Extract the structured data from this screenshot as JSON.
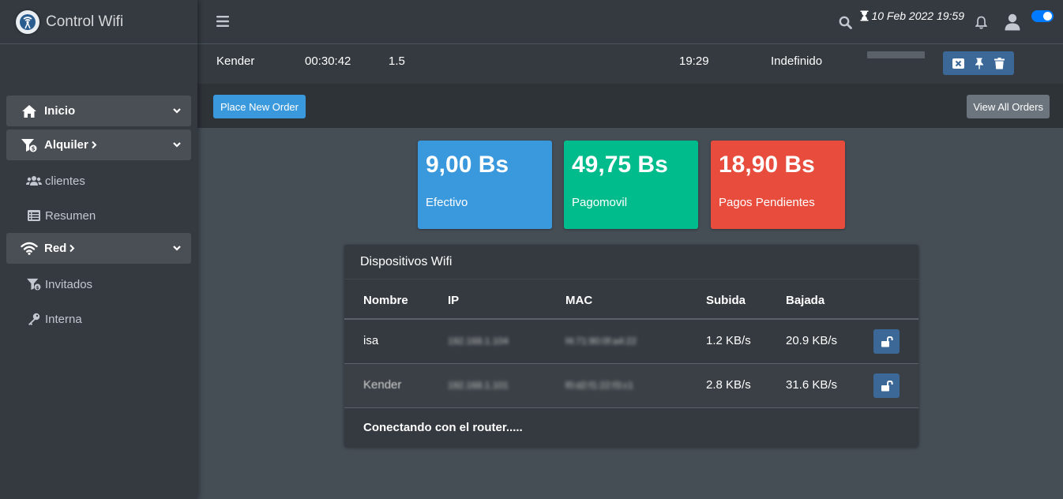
{
  "brand": {
    "name": "Control Wifi"
  },
  "sidebar": {
    "items": [
      {
        "type": "group",
        "label": "Inicio",
        "icon": "home-icon"
      },
      {
        "type": "group",
        "label": "Alquiler",
        "icon": "filter-money-icon"
      },
      {
        "type": "sub",
        "label": "clientes",
        "icon": "users-icon"
      },
      {
        "type": "sub",
        "label": "Resumen",
        "icon": "list-icon"
      },
      {
        "type": "group",
        "label": "Red",
        "icon": "wifi-icon"
      },
      {
        "type": "sub",
        "label": "Invitados",
        "icon": "filter-money-icon"
      },
      {
        "type": "sub",
        "label": "Interna",
        "icon": "key-icon"
      }
    ]
  },
  "header": {
    "date": "10 Feb 2022 19:59",
    "toggle_on": true,
    "accent": "#007bff"
  },
  "order": {
    "name": "Kender",
    "duration": "00:30:42",
    "amount": "1.5",
    "time": "19:29",
    "status": "Indefinido"
  },
  "orders_bar": {
    "place_label": "Place New Order",
    "view_all_label": "View All Orders"
  },
  "stats": [
    {
      "amount": "9,00 Bs",
      "label": "Efectivo",
      "color": "#3a98dd"
    },
    {
      "amount": "49,75 Bs",
      "label": "Pagomovil",
      "color": "#00bc8c"
    },
    {
      "amount": "18,90 Bs",
      "label": "Pagos Pendientes",
      "color": "#e74c3c"
    }
  ],
  "devices": {
    "title": "Dispositivos Wifi",
    "columns": [
      "Nombre",
      "IP",
      "MAC",
      "Subida",
      "Bajada"
    ],
    "rows": [
      {
        "name": "isa",
        "ip": "192.168.1.104",
        "mac": "f4:71:90:0f:a4:22",
        "up": "1.2 KB/s",
        "down": "20.9 KB/s"
      },
      {
        "name": "Kender",
        "ip": "192.168.1.101",
        "mac": "f0:d2:f1:22:f3:c1",
        "up": "2.8 KB/s",
        "down": "31.6 KB/s"
      }
    ],
    "footer": "Conectando con el router....."
  }
}
